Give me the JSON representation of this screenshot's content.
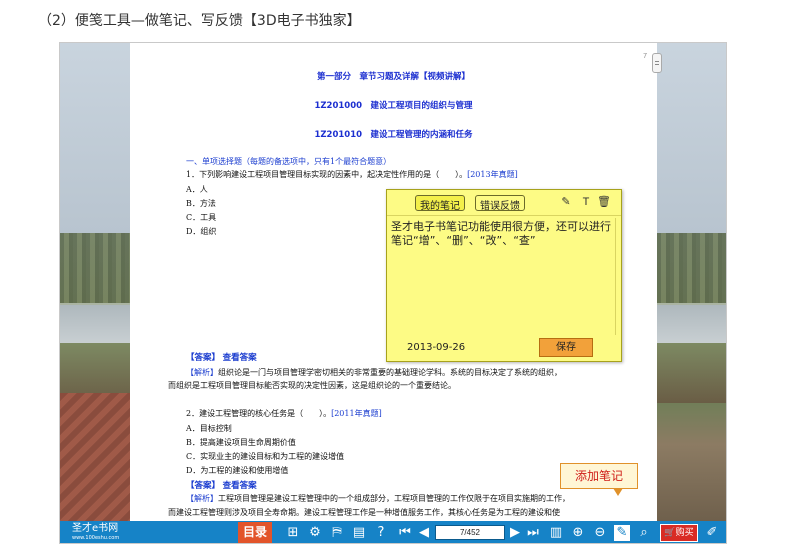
{
  "heading": "（2）便笺工具—做笔记、写反馈【3D电子书独家】",
  "page": {
    "page_number": "7",
    "title1": "第一部分　章节习题及详解【视频讲解】",
    "title2": "1Z201000　建设工程项目的组织与管理",
    "title3": "1Z201010　建设工程管理的内涵和任务",
    "section": "一、单项选择题（每题的备选项中，只有1个最符合题意）",
    "q1": "1．下列影响建设工程项目管理目标实现的因素中，起决定性作用的是（　　）。",
    "q1_year": "[2013年真题]",
    "q1_options": [
      "A．人",
      "B．方法",
      "C．工具",
      "D．组织"
    ],
    "answer_label": "【答案】",
    "answer_link": "查看答案",
    "analysis_label": "【解析】",
    "analysis1_line1": "组织论是一门与项目管理学密切相关的非常重要的基础理论学科。系统的目标决定了系统的组织，",
    "analysis1_line2": "而组织是工程项目管理目标能否实现的决定性因素，这是组织论的一个重要结论。",
    "q2": "2．建设工程管理的核心任务是（　　）。",
    "q2_year": "[2011年真题]",
    "q2_options": [
      "A．目标控制",
      "B．提高建设项目生命周期价值",
      "C．实现业主的建设目标和为工程的建设增值",
      "D．为工程的建设和使用增值"
    ],
    "analysis2_line1": "工程项目管理是建设工程管理中的一个组成部分，工程项目管理的工作仅限于在项目实施期的工作，",
    "analysis2_line2": "而建设工程管理则涉及项目全寿命期。建设工程管理工作是一种增值服务工作，其核心任务是为工程的建设和使"
  },
  "note": {
    "tab_my_notes": "我的笔记",
    "tab_feedback": "错误反馈",
    "text": "圣才电子书笔记功能使用很方便，还可以进行笔记“增”、“删”、“改”、“查”",
    "date": "2013-09-26",
    "save": "保存"
  },
  "tooltip": "添加笔记",
  "toolbar": {
    "logo": "圣才e书网",
    "logo_url": "www.100eshu.com",
    "contents": "目录",
    "page_indicator": "7/452",
    "buy": "购买"
  }
}
